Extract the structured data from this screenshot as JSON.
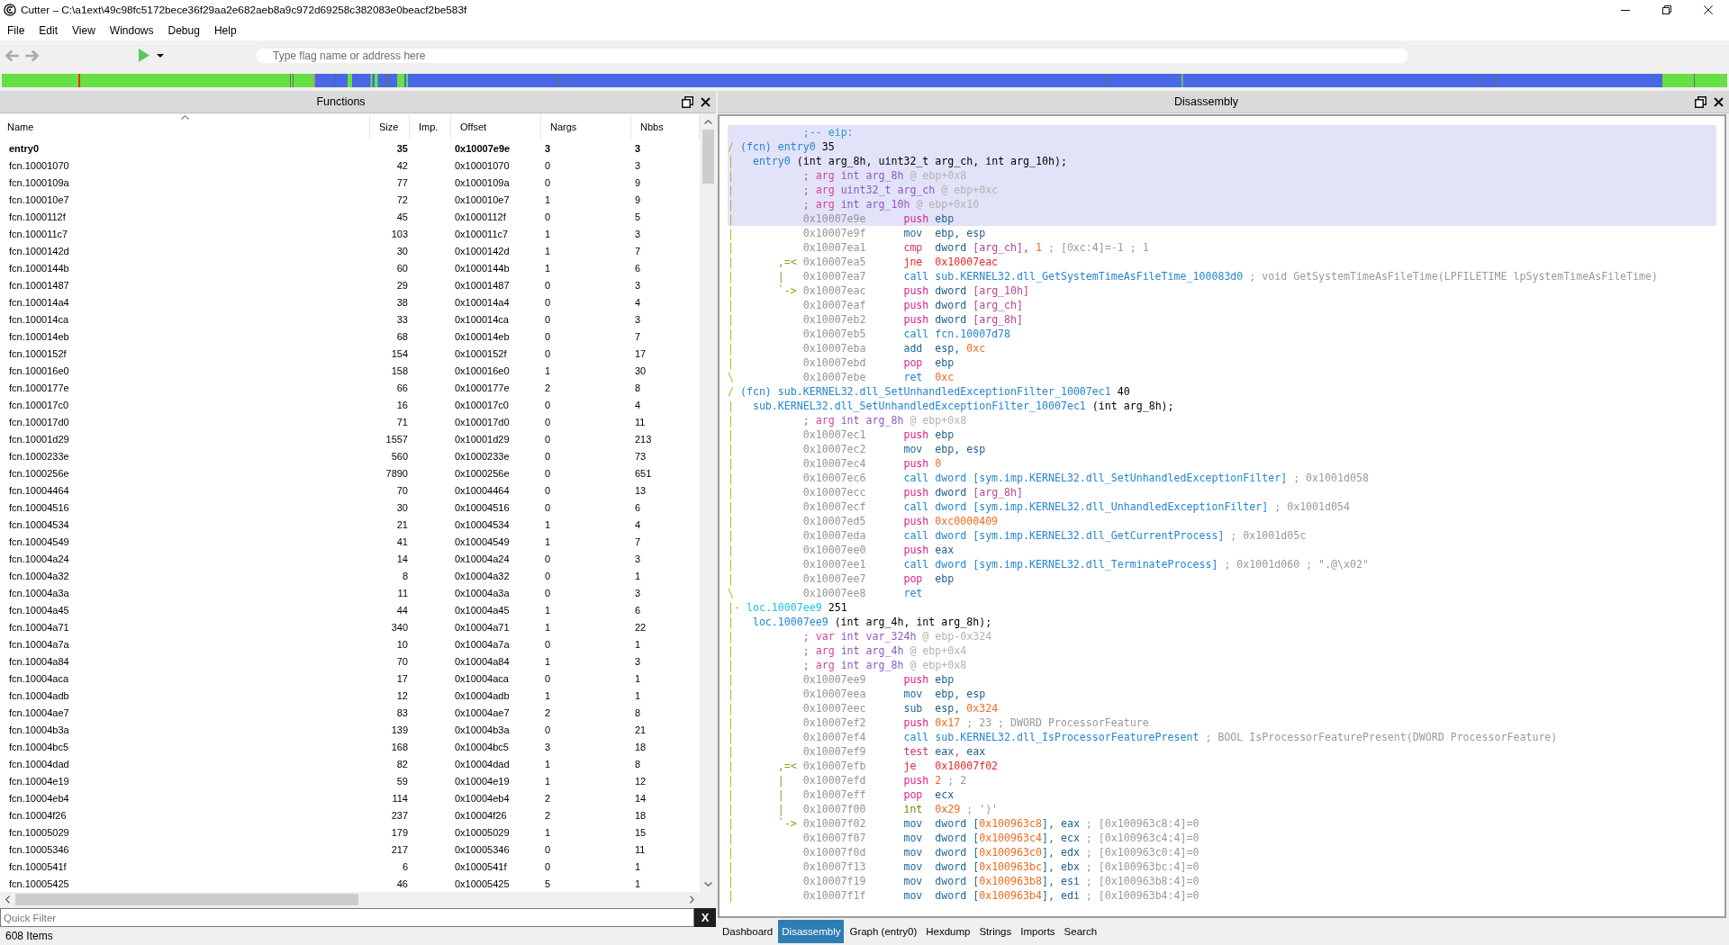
{
  "window": {
    "title": "Cutter – C:\\a1ext\\49c98fc5172bece36f29aa2e682aeb8a9c972d69258c382083e0beacf2be583f"
  },
  "menu": [
    "File",
    "Edit",
    "View",
    "Windows",
    "Debug",
    "Help"
  ],
  "toolbar": {
    "back": {
      "disabled": true
    },
    "forward": {
      "disabled": true
    },
    "search": {
      "placeholder": "Type flag name or address here"
    }
  },
  "functions": {
    "title": "Functions",
    "columns": [
      {
        "label": "Name",
        "sorted": true
      },
      {
        "label": "Size",
        "sorted": false
      },
      {
        "label": "Imp.",
        "sorted": false
      },
      {
        "label": "Offset",
        "sorted": false
      },
      {
        "label": "Nargs",
        "sorted": false
      },
      {
        "label": "Nbbs",
        "sorted": false
      }
    ],
    "rows": [
      {
        "name": "entry0",
        "size": "35",
        "offset": "0x10007e9e",
        "nargs": "3",
        "nbbs": "3",
        "current": true
      },
      {
        "name": "fcn.10001070",
        "size": "42",
        "offset": "0x10001070",
        "nargs": "0",
        "nbbs": "3",
        "current": false
      },
      {
        "name": "fcn.1000109a",
        "size": "77",
        "offset": "0x1000109a",
        "nargs": "0",
        "nbbs": "9",
        "current": false
      },
      {
        "name": "fcn.100010e7",
        "size": "72",
        "offset": "0x100010e7",
        "nargs": "1",
        "nbbs": "9",
        "current": false
      },
      {
        "name": "fcn.1000112f",
        "size": "45",
        "offset": "0x1000112f",
        "nargs": "0",
        "nbbs": "5",
        "current": false
      },
      {
        "name": "fcn.100011c7",
        "size": "103",
        "offset": "0x100011c7",
        "nargs": "1",
        "nbbs": "3",
        "current": false
      },
      {
        "name": "fcn.1000142d",
        "size": "30",
        "offset": "0x1000142d",
        "nargs": "1",
        "nbbs": "7",
        "current": false
      },
      {
        "name": "fcn.1000144b",
        "size": "60",
        "offset": "0x1000144b",
        "nargs": "1",
        "nbbs": "6",
        "current": false
      },
      {
        "name": "fcn.10001487",
        "size": "29",
        "offset": "0x10001487",
        "nargs": "0",
        "nbbs": "3",
        "current": false
      },
      {
        "name": "fcn.100014a4",
        "size": "38",
        "offset": "0x100014a4",
        "nargs": "0",
        "nbbs": "4",
        "current": false
      },
      {
        "name": "fcn.100014ca",
        "size": "33",
        "offset": "0x100014ca",
        "nargs": "0",
        "nbbs": "3",
        "current": false
      },
      {
        "name": "fcn.100014eb",
        "size": "68",
        "offset": "0x100014eb",
        "nargs": "0",
        "nbbs": "7",
        "current": false
      },
      {
        "name": "fcn.1000152f",
        "size": "154",
        "offset": "0x1000152f",
        "nargs": "0",
        "nbbs": "17",
        "current": false
      },
      {
        "name": "fcn.100016e0",
        "size": "158",
        "offset": "0x100016e0",
        "nargs": "1",
        "nbbs": "30",
        "current": false
      },
      {
        "name": "fcn.1000177e",
        "size": "66",
        "offset": "0x1000177e",
        "nargs": "2",
        "nbbs": "8",
        "current": false
      },
      {
        "name": "fcn.100017c0",
        "size": "16",
        "offset": "0x100017c0",
        "nargs": "0",
        "nbbs": "4",
        "current": false
      },
      {
        "name": "fcn.100017d0",
        "size": "71",
        "offset": "0x100017d0",
        "nargs": "0",
        "nbbs": "11",
        "current": false
      },
      {
        "name": "fcn.10001d29",
        "size": "1557",
        "offset": "0x10001d29",
        "nargs": "0",
        "nbbs": "213",
        "current": false
      },
      {
        "name": "fcn.1000233e",
        "size": "560",
        "offset": "0x1000233e",
        "nargs": "0",
        "nbbs": "73",
        "current": false
      },
      {
        "name": "fcn.1000256e",
        "size": "7890",
        "offset": "0x1000256e",
        "nargs": "0",
        "nbbs": "651",
        "current": false
      },
      {
        "name": "fcn.10004464",
        "size": "70",
        "offset": "0x10004464",
        "nargs": "0",
        "nbbs": "13",
        "current": false
      },
      {
        "name": "fcn.10004516",
        "size": "30",
        "offset": "0x10004516",
        "nargs": "0",
        "nbbs": "6",
        "current": false
      },
      {
        "name": "fcn.10004534",
        "size": "21",
        "offset": "0x10004534",
        "nargs": "1",
        "nbbs": "4",
        "current": false
      },
      {
        "name": "fcn.10004549",
        "size": "41",
        "offset": "0x10004549",
        "nargs": "1",
        "nbbs": "7",
        "current": false
      },
      {
        "name": "fcn.10004a24",
        "size": "14",
        "offset": "0x10004a24",
        "nargs": "0",
        "nbbs": "3",
        "current": false
      },
      {
        "name": "fcn.10004a32",
        "size": "8",
        "offset": "0x10004a32",
        "nargs": "0",
        "nbbs": "1",
        "current": false
      },
      {
        "name": "fcn.10004a3a",
        "size": "11",
        "offset": "0x10004a3a",
        "nargs": "0",
        "nbbs": "3",
        "current": false
      },
      {
        "name": "fcn.10004a45",
        "size": "44",
        "offset": "0x10004a45",
        "nargs": "1",
        "nbbs": "6",
        "current": false
      },
      {
        "name": "fcn.10004a71",
        "size": "340",
        "offset": "0x10004a71",
        "nargs": "1",
        "nbbs": "22",
        "current": false
      },
      {
        "name": "fcn.10004a7a",
        "size": "10",
        "offset": "0x10004a7a",
        "nargs": "0",
        "nbbs": "1",
        "current": false
      },
      {
        "name": "fcn.10004a84",
        "size": "70",
        "offset": "0x10004a84",
        "nargs": "1",
        "nbbs": "3",
        "current": false
      },
      {
        "name": "fcn.10004aca",
        "size": "17",
        "offset": "0x10004aca",
        "nargs": "0",
        "nbbs": "1",
        "current": false
      },
      {
        "name": "fcn.10004adb",
        "size": "12",
        "offset": "0x10004adb",
        "nargs": "1",
        "nbbs": "1",
        "current": false
      },
      {
        "name": "fcn.10004ae7",
        "size": "83",
        "offset": "0x10004ae7",
        "nargs": "2",
        "nbbs": "8",
        "current": false
      },
      {
        "name": "fcn.10004b3a",
        "size": "139",
        "offset": "0x10004b3a",
        "nargs": "0",
        "nbbs": "21",
        "current": false
      },
      {
        "name": "fcn.10004bc5",
        "size": "168",
        "offset": "0x10004bc5",
        "nargs": "3",
        "nbbs": "18",
        "current": false
      },
      {
        "name": "fcn.10004dad",
        "size": "82",
        "offset": "0x10004dad",
        "nargs": "1",
        "nbbs": "8",
        "current": false
      },
      {
        "name": "fcn.10004e19",
        "size": "59",
        "offset": "0x10004e19",
        "nargs": "1",
        "nbbs": "12",
        "current": false
      },
      {
        "name": "fcn.10004eb4",
        "size": "114",
        "offset": "0x10004eb4",
        "nargs": "2",
        "nbbs": "14",
        "current": false
      },
      {
        "name": "fcn.10004f26",
        "size": "237",
        "offset": "0x10004f26",
        "nargs": "2",
        "nbbs": "18",
        "current": false
      },
      {
        "name": "fcn.10005029",
        "size": "179",
        "offset": "0x10005029",
        "nargs": "1",
        "nbbs": "15",
        "current": false
      },
      {
        "name": "fcn.10005346",
        "size": "217",
        "offset": "0x10005346",
        "nargs": "0",
        "nbbs": "11",
        "current": false
      },
      {
        "name": "fcn.1000541f",
        "size": "6",
        "offset": "0x1000541f",
        "nargs": "0",
        "nbbs": "1",
        "current": false
      },
      {
        "name": "fcn.10005425",
        "size": "46",
        "offset": "0x10005425",
        "nargs": "5",
        "nbbs": "1",
        "current": false
      }
    ],
    "quick_filter": {
      "placeholder": "Quick Filter"
    },
    "clear_button": "X",
    "item_count": "608 Items"
  },
  "disassembly": {
    "title": "Disassembly",
    "lines": [
      {
        "kind": "flag",
        "text": ";-- eip:",
        "selected": true
      },
      {
        "kind": "function",
        "bar": "/",
        "label": "(fcn) entry0",
        "color": "#2486d2",
        "size": "35",
        "selected": true
      },
      {
        "kind": "signature",
        "bar": "|",
        "name": "entry0",
        "params": "(int arg_8h, uint32_t arg_ch, int arg_10h);",
        "selected": true
      },
      {
        "kind": "variable",
        "bar": "|",
        "prefix": "; arg",
        "decl": "int arg_8h",
        "location": "@ ebp+0x8",
        "selected": true
      },
      {
        "kind": "variable",
        "bar": "|",
        "prefix": "; arg",
        "decl": "uint32_t arg_ch",
        "location": "@ ebp+0xc",
        "selected": true
      },
      {
        "kind": "variable",
        "bar": "|",
        "prefix": "; arg",
        "decl": "int arg_10h",
        "location": "@ ebp+0x10",
        "selected": true
      },
      {
        "kind": "instruction",
        "bar": "|",
        "address": "0x10007e9e",
        "color": "#de2088",
        "mnemonic": "push",
        "operands": [
          {
            "text": "ebp",
            "kind": "reg"
          }
        ],
        "selected": true
      },
      {
        "kind": "instruction",
        "bar": "|",
        "address": "0x10007e9f",
        "color": "#1f6a9a",
        "mnemonic": "mov",
        "operands": [
          {
            "text": "ebp",
            "kind": "reg"
          },
          {
            "text": ", ",
            "kind": "op"
          },
          {
            "text": "esp",
            "kind": "reg"
          }
        ],
        "selected": false
      },
      {
        "kind": "instruction",
        "bar": "|",
        "address": "0x10007ea1",
        "color": "#d6336a",
        "mnemonic": "cmp",
        "operands": [
          {
            "text": "dword ",
            "kind": "type"
          },
          {
            "text": "[arg_ch]",
            "kind": "var"
          },
          {
            "text": ", ",
            "kind": "op"
          },
          {
            "text": "1",
            "kind": "num"
          }
        ],
        "comment": "; [0xc:4]=-1 ; 1",
        "selected": false
      },
      {
        "kind": "instruction",
        "bar": "|",
        "flow": ",=<",
        "address": "0x10007ea5",
        "color": "#e32a2a",
        "mnemonic": "jne",
        "operands": [
          {
            "text": "0x10007eac",
            "kind": "op"
          }
        ],
        "selected": false
      },
      {
        "kind": "instruction",
        "bar": "|",
        "flow": "|",
        "address": "0x10007ea7",
        "color": "#2486d2",
        "mnemonic": "call",
        "operands": [
          {
            "text": "sub.KERNEL32.dll_GetSystemTimeAsFileTime_100083d0",
            "kind": "op"
          }
        ],
        "comment": "; void GetSystemTimeAsFileTime(LPFILETIME lpSystemTimeAsFileTime)",
        "selected": false
      },
      {
        "kind": "instruction",
        "bar": "|",
        "flow": "`->",
        "address": "0x10007eac",
        "color": "#de2088",
        "mnemonic": "push",
        "operands": [
          {
            "text": "dword ",
            "kind": "type"
          },
          {
            "text": "[arg_10h]",
            "kind": "var"
          }
        ],
        "selected": false
      },
      {
        "kind": "instruction",
        "bar": "|",
        "address": "0x10007eaf",
        "color": "#de2088",
        "mnemonic": "push",
        "operands": [
          {
            "text": "dword ",
            "kind": "type"
          },
          {
            "text": "[arg_ch]",
            "kind": "var"
          }
        ],
        "selected": false
      },
      {
        "kind": "instruction",
        "bar": "|",
        "address": "0x10007eb2",
        "color": "#de2088",
        "mnemonic": "push",
        "operands": [
          {
            "text": "dword ",
            "kind": "type"
          },
          {
            "text": "[arg_8h]",
            "kind": "var"
          }
        ],
        "selected": false
      },
      {
        "kind": "instruction",
        "bar": "|",
        "address": "0x10007eb5",
        "color": "#2486d2",
        "mnemonic": "call",
        "operands": [
          {
            "text": "fcn.10007d78",
            "kind": "op"
          }
        ],
        "selected": false
      },
      {
        "kind": "instruction",
        "bar": "|",
        "address": "0x10007eba",
        "color": "#1f6a9a",
        "mnemonic": "add",
        "operands": [
          {
            "text": "esp",
            "kind": "reg"
          },
          {
            "text": ", ",
            "kind": "op"
          },
          {
            "text": "0xc",
            "kind": "num"
          }
        ],
        "selected": false
      },
      {
        "kind": "instruction",
        "bar": "|",
        "address": "0x10007ebd",
        "color": "#de2088",
        "mnemonic": "pop",
        "operands": [
          {
            "text": "ebp",
            "kind": "reg"
          }
        ],
        "selected": false
      },
      {
        "kind": "instruction",
        "bar": "\\",
        "address": "0x10007ebe",
        "color": "#2486d2",
        "mnemonic": "ret",
        "operands": [
          {
            "text": "0xc",
            "kind": "num"
          }
        ],
        "selected": false
      },
      {
        "kind": "function",
        "bar": "/",
        "label": "(fcn) sub.KERNEL32.dll_SetUnhandledExceptionFilter_10007ec1",
        "color": "#2486d2",
        "size": "40",
        "selected": false
      },
      {
        "kind": "signature",
        "bar": "|",
        "name": "sub.KERNEL32.dll_SetUnhandledExceptionFilter_10007ec1",
        "params": "(int arg_8h);",
        "selected": false
      },
      {
        "kind": "variable",
        "bar": "|",
        "prefix": "; arg",
        "decl": "int arg_8h",
        "location": "@ ebp+0x8",
        "selected": false
      },
      {
        "kind": "instruction",
        "bar": "|",
        "address": "0x10007ec1",
        "color": "#de2088",
        "mnemonic": "push",
        "operands": [
          {
            "text": "ebp",
            "kind": "reg"
          }
        ],
        "selected": false
      },
      {
        "kind": "instruction",
        "bar": "|",
        "address": "0x10007ec2",
        "color": "#1f6a9a",
        "mnemonic": "mov",
        "operands": [
          {
            "text": "ebp",
            "kind": "reg"
          },
          {
            "text": ", ",
            "kind": "op"
          },
          {
            "text": "esp",
            "kind": "reg"
          }
        ],
        "selected": false
      },
      {
        "kind": "instruction",
        "bar": "|",
        "address": "0x10007ec4",
        "color": "#de2088",
        "mnemonic": "push",
        "operands": [
          {
            "text": "0",
            "kind": "num"
          }
        ],
        "selected": false
      },
      {
        "kind": "instruction",
        "bar": "|",
        "address": "0x10007ec6",
        "color": "#2486d2",
        "mnemonic": "call",
        "operands": [
          {
            "text": "dword [sym.imp.KERNEL32.dll_SetUnhandledExceptionFilter]",
            "kind": "op"
          }
        ],
        "comment": "; 0x1001d058",
        "selected": false
      },
      {
        "kind": "instruction",
        "bar": "|",
        "address": "0x10007ecc",
        "color": "#de2088",
        "mnemonic": "push",
        "operands": [
          {
            "text": "dword ",
            "kind": "type"
          },
          {
            "text": "[arg_8h]",
            "kind": "var"
          }
        ],
        "selected": false
      },
      {
        "kind": "instruction",
        "bar": "|",
        "address": "0x10007ecf",
        "color": "#2486d2",
        "mnemonic": "call",
        "operands": [
          {
            "text": "dword [sym.imp.KERNEL32.dll_UnhandledExceptionFilter]",
            "kind": "op"
          }
        ],
        "comment": "; 0x1001d054",
        "selected": false
      },
      {
        "kind": "instruction",
        "bar": "|",
        "address": "0x10007ed5",
        "color": "#de2088",
        "mnemonic": "push",
        "operands": [
          {
            "text": "0xc0000409",
            "kind": "num"
          }
        ],
        "selected": false
      },
      {
        "kind": "instruction",
        "bar": "|",
        "address": "0x10007eda",
        "color": "#2486d2",
        "mnemonic": "call",
        "operands": [
          {
            "text": "dword [sym.imp.KERNEL32.dll_GetCurrentProcess]",
            "kind": "op"
          }
        ],
        "comment": "; 0x1001d05c",
        "selected": false
      },
      {
        "kind": "instruction",
        "bar": "|",
        "address": "0x10007ee0",
        "color": "#de2088",
        "mnemonic": "push",
        "operands": [
          {
            "text": "eax",
            "kind": "reg"
          }
        ],
        "selected": false
      },
      {
        "kind": "instruction",
        "bar": "|",
        "address": "0x10007ee1",
        "color": "#2486d2",
        "mnemonic": "call",
        "operands": [
          {
            "text": "dword [sym.imp.KERNEL32.dll_TerminateProcess]",
            "kind": "op"
          }
        ],
        "comment": "; 0x1001d060 ; \".@\\x02\"",
        "selected": false
      },
      {
        "kind": "instruction",
        "bar": "|",
        "address": "0x10007ee7",
        "color": "#de2088",
        "mnemonic": "pop",
        "operands": [
          {
            "text": "ebp",
            "kind": "reg"
          }
        ],
        "selected": false
      },
      {
        "kind": "instruction",
        "bar": "\\",
        "address": "0x10007ee8",
        "color": "#2486d2",
        "mnemonic": "ret",
        "selected": false
      },
      {
        "kind": "function",
        "bar": "|-",
        "label": "loc.10007ee9",
        "color": "#1fc4dc",
        "size": "251",
        "selected": false
      },
      {
        "kind": "signature",
        "bar": "|",
        "name": "loc.10007ee9",
        "params": "(int arg_4h, int arg_8h);",
        "selected": false
      },
      {
        "kind": "variable",
        "bar": "|",
        "prefix": "; var",
        "decl": "int var_324h",
        "location": "@ ebp-0x324",
        "selected": false
      },
      {
        "kind": "variable",
        "bar": "|",
        "prefix": "; arg",
        "decl": "int arg_4h",
        "location": "@ ebp+0x4",
        "selected": false
      },
      {
        "kind": "variable",
        "bar": "|",
        "prefix": "; arg",
        "decl": "int arg_8h",
        "location": "@ ebp+0x8",
        "selected": false
      },
      {
        "kind": "instruction",
        "bar": "|",
        "address": "0x10007ee9",
        "color": "#de2088",
        "mnemonic": "push",
        "operands": [
          {
            "text": "ebp",
            "kind": "reg"
          }
        ],
        "selected": false
      },
      {
        "kind": "instruction",
        "bar": "|",
        "address": "0x10007eea",
        "color": "#1f6a9a",
        "mnemonic": "mov",
        "operands": [
          {
            "text": "ebp",
            "kind": "reg"
          },
          {
            "text": ", ",
            "kind": "op"
          },
          {
            "text": "esp",
            "kind": "reg"
          }
        ],
        "selected": false
      },
      {
        "kind": "instruction",
        "bar": "|",
        "address": "0x10007eec",
        "color": "#1f6a9a",
        "mnemonic": "sub",
        "operands": [
          {
            "text": "esp",
            "kind": "reg"
          },
          {
            "text": ", ",
            "kind": "op"
          },
          {
            "text": "0x324",
            "kind": "num"
          }
        ],
        "selected": false
      },
      {
        "kind": "instruction",
        "bar": "|",
        "address": "0x10007ef2",
        "color": "#de2088",
        "mnemonic": "push",
        "operands": [
          {
            "text": "0x17",
            "kind": "num"
          }
        ],
        "comment": "; 23 ; DWORD ProcessorFeature",
        "selected": false
      },
      {
        "kind": "instruction",
        "bar": "|",
        "address": "0x10007ef4",
        "color": "#2486d2",
        "mnemonic": "call",
        "operands": [
          {
            "text": "sub.KERNEL32.dll_IsProcessorFeaturePresent",
            "kind": "op"
          }
        ],
        "comment": "; BOOL IsProcessorFeaturePresent(DWORD ProcessorFeature)",
        "selected": false
      },
      {
        "kind": "instruction",
        "bar": "|",
        "address": "0x10007ef9",
        "color": "#d6336a",
        "mnemonic": "test",
        "operands": [
          {
            "text": "eax",
            "kind": "reg"
          },
          {
            "text": ", ",
            "kind": "op"
          },
          {
            "text": "eax",
            "kind": "reg"
          }
        ],
        "selected": false
      },
      {
        "kind": "instruction",
        "bar": "|",
        "flow": ",=<",
        "address": "0x10007efb",
        "color": "#e32a2a",
        "mnemonic": "je",
        "operands": [
          {
            "text": "0x10007f02",
            "kind": "op"
          }
        ],
        "selected": false
      },
      {
        "kind": "instruction",
        "bar": "|",
        "flow": "|",
        "address": "0x10007efd",
        "color": "#de2088",
        "mnemonic": "push",
        "operands": [
          {
            "text": "2",
            "kind": "num"
          }
        ],
        "comment": "; 2",
        "selected": false
      },
      {
        "kind": "instruction",
        "bar": "|",
        "flow": "|",
        "address": "0x10007eff",
        "color": "#de2088",
        "mnemonic": "pop",
        "operands": [
          {
            "text": "ecx",
            "kind": "reg"
          }
        ],
        "selected": false
      },
      {
        "kind": "instruction",
        "bar": "|",
        "flow": "|",
        "address": "0x10007f00",
        "color": "#7a8a00",
        "mnemonic": "int",
        "operands": [
          {
            "text": "0x29",
            "kind": "num"
          }
        ],
        "comment": "; ')'",
        "selected": false
      },
      {
        "kind": "instruction",
        "bar": "|",
        "flow": "`->",
        "address": "0x10007f02",
        "color": "#1f6a9a",
        "mnemonic": "mov",
        "operands": [
          {
            "text": "dword [",
            "kind": "op"
          },
          {
            "text": "0x100963c8",
            "kind": "num"
          },
          {
            "text": "], ",
            "kind": "op"
          },
          {
            "text": "eax",
            "kind": "reg"
          }
        ],
        "comment": "; [0x100963c8:4]=0",
        "selected": false
      },
      {
        "kind": "instruction",
        "bar": "|",
        "address": "0x10007f07",
        "color": "#1f6a9a",
        "mnemonic": "mov",
        "operands": [
          {
            "text": "dword [",
            "kind": "op"
          },
          {
            "text": "0x100963c4",
            "kind": "num"
          },
          {
            "text": "], ",
            "kind": "op"
          },
          {
            "text": "ecx",
            "kind": "reg"
          }
        ],
        "comment": "; [0x100963c4:4]=0",
        "selected": false
      },
      {
        "kind": "instruction",
        "bar": "|",
        "address": "0x10007f0d",
        "color": "#1f6a9a",
        "mnemonic": "mov",
        "operands": [
          {
            "text": "dword [",
            "kind": "op"
          },
          {
            "text": "0x100963c0",
            "kind": "num"
          },
          {
            "text": "], ",
            "kind": "op"
          },
          {
            "text": "edx",
            "kind": "reg"
          }
        ],
        "comment": "; [0x100963c0:4]=0",
        "selected": false
      },
      {
        "kind": "instruction",
        "bar": "|",
        "address": "0x10007f13",
        "color": "#1f6a9a",
        "mnemonic": "mov",
        "operands": [
          {
            "text": "dword [",
            "kind": "op"
          },
          {
            "text": "0x100963bc",
            "kind": "num"
          },
          {
            "text": "], ",
            "kind": "op"
          },
          {
            "text": "ebx",
            "kind": "reg"
          }
        ],
        "comment": "; [0x100963bc:4]=0",
        "selected": false
      },
      {
        "kind": "instruction",
        "bar": "|",
        "address": "0x10007f19",
        "color": "#1f6a9a",
        "mnemonic": "mov",
        "operands": [
          {
            "text": "dword [",
            "kind": "op"
          },
          {
            "text": "0x100963b8",
            "kind": "num"
          },
          {
            "text": "], ",
            "kind": "op"
          },
          {
            "text": "esi",
            "kind": "reg"
          }
        ],
        "comment": "; [0x100963b8:4]=0",
        "selected": false
      },
      {
        "kind": "instruction",
        "bar": "|",
        "address": "0x10007f1f",
        "color": "#1f6a9a",
        "mnemonic": "mov",
        "operands": [
          {
            "text": "dword [",
            "kind": "op"
          },
          {
            "text": "0x100963b4",
            "kind": "num"
          },
          {
            "text": "], ",
            "kind": "op"
          },
          {
            "text": "edi",
            "kind": "reg"
          }
        ],
        "comment": "; [0x100963b4:4]=0",
        "selected": false
      }
    ]
  },
  "tabs": [
    {
      "label": "Dashboard",
      "selected": false
    },
    {
      "label": "Disassembly",
      "selected": true
    },
    {
      "label": "Graph (entry0)",
      "selected": false
    },
    {
      "label": "Hexdump",
      "selected": false
    },
    {
      "label": "Strings",
      "selected": false
    },
    {
      "label": "Imports",
      "selected": false
    },
    {
      "label": "Search",
      "selected": false
    }
  ]
}
